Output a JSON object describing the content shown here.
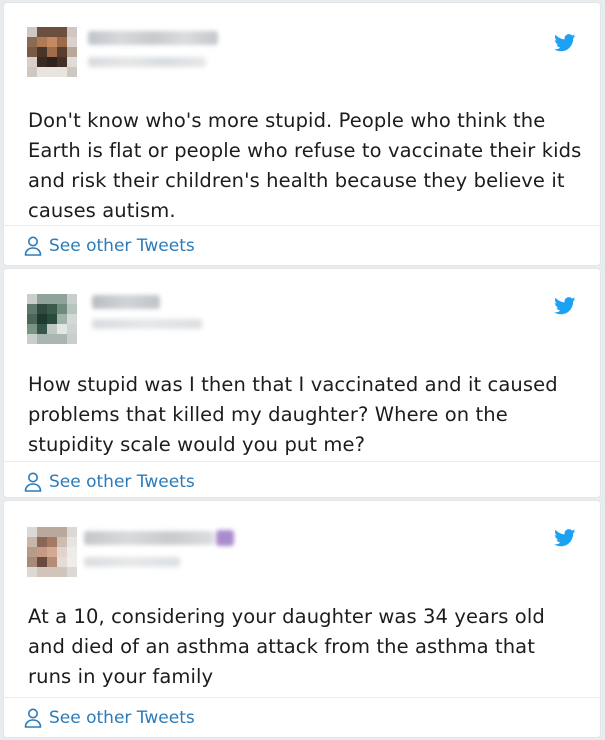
{
  "theme": {
    "accent": "#2b7bb9",
    "twitter_blue": "#1da1f2",
    "text": "#1c1c1c"
  },
  "tweets": [
    {
      "text": "Don't know who's more stupid. People who think the Earth is flat or people who refuse to vaccinate their kids and risk their children's health because they believe it causes autism.",
      "see_other": "See other Tweets",
      "icon": "twitter-bird-icon"
    },
    {
      "text": "How stupid was I then that I vaccinated and it caused problems that killed my daughter? Where on the stupidity scale would you put me?",
      "see_other": "See other Tweets",
      "icon": "twitter-bird-icon"
    },
    {
      "text": "At a 10, considering your daughter was 34 years old and died of an asthma attack from the asthma that runs in your family",
      "see_other": "See other Tweets",
      "icon": "twitter-bird-icon"
    }
  ]
}
